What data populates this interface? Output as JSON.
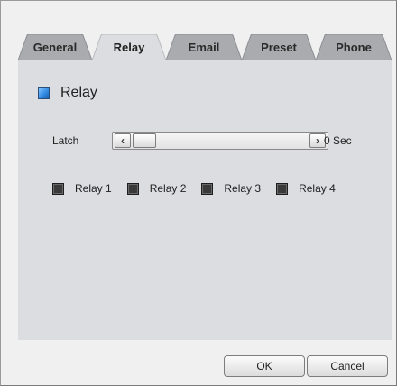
{
  "tabs": [
    {
      "label": "General",
      "active": false
    },
    {
      "label": "Relay",
      "active": true
    },
    {
      "label": "Email",
      "active": false
    },
    {
      "label": "Preset",
      "active": false
    },
    {
      "label": "Phone",
      "active": false
    }
  ],
  "section": {
    "title": "Relay",
    "checked": true
  },
  "latch": {
    "label": "Latch",
    "left_glyph": "‹",
    "right_glyph": "›",
    "value_text": "0 Sec",
    "value": 0
  },
  "relays": [
    {
      "label": "Relay 1",
      "checked": false
    },
    {
      "label": "Relay 2",
      "checked": false
    },
    {
      "label": "Relay 3",
      "checked": false
    },
    {
      "label": "Relay 4",
      "checked": false
    }
  ],
  "buttons": {
    "ok": "OK",
    "cancel": "Cancel"
  },
  "colors": {
    "tab_inactive": "#a9abaf",
    "tab_active": "#dcdde0",
    "panel": "#dcdde0",
    "check_accent": "#2e86de"
  }
}
